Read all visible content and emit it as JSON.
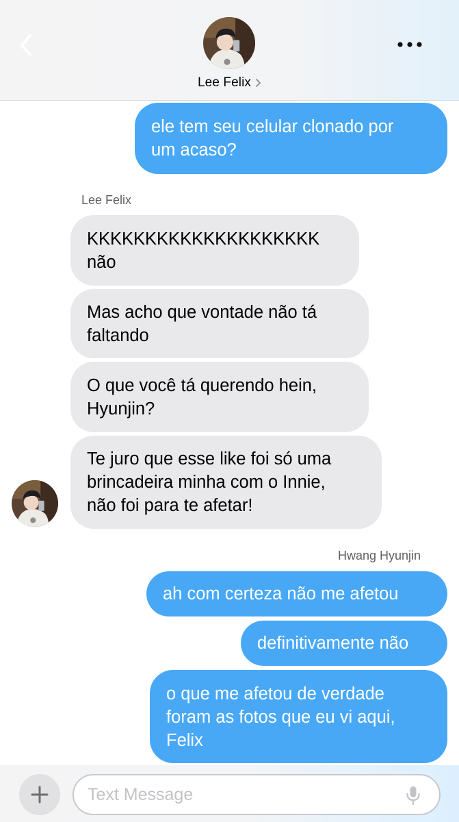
{
  "header": {
    "contact_name": "Lee Felix",
    "back_icon": "chevron-left-icon",
    "more_icon": "ellipsis-icon",
    "name_chevron_icon": "chevron-right-icon"
  },
  "messages": [
    {
      "side": "outgoing",
      "text": "ele tem seu celular clonado por\num acaso?"
    },
    {
      "side": "sender_label",
      "text": "Lee Felix"
    },
    {
      "side": "incoming",
      "text": "KKKKKKKKKKKKKKKKKKKK\nnão"
    },
    {
      "side": "incoming",
      "text": "Mas acho que vontade não tá\nfaltando"
    },
    {
      "side": "incoming",
      "text": "O que você tá querendo hein,\nHyunjin?"
    },
    {
      "side": "incoming",
      "text": "Te juro que esse like foi só uma\nbrincadeira minha com o Innie,\nnão foi para te afetar!"
    },
    {
      "side": "sender_label",
      "text": "Hwang Hyunjin"
    },
    {
      "side": "outgoing",
      "text": "ah com certeza não me afetou"
    },
    {
      "side": "outgoing",
      "text": "definitivamente não"
    },
    {
      "side": "outgoing",
      "text": "o que me afetou de verdade\nforam as fotos que eu vi aqui,\nFelix"
    }
  ],
  "composer": {
    "placeholder": "Text Message",
    "value": "",
    "add_icon": "plus-icon",
    "mic_icon": "microphone-icon"
  },
  "colors": {
    "outgoing_bubble": "#48a8f6",
    "incoming_bubble": "#e9e9eb",
    "sender_label": "#5f5f63"
  }
}
